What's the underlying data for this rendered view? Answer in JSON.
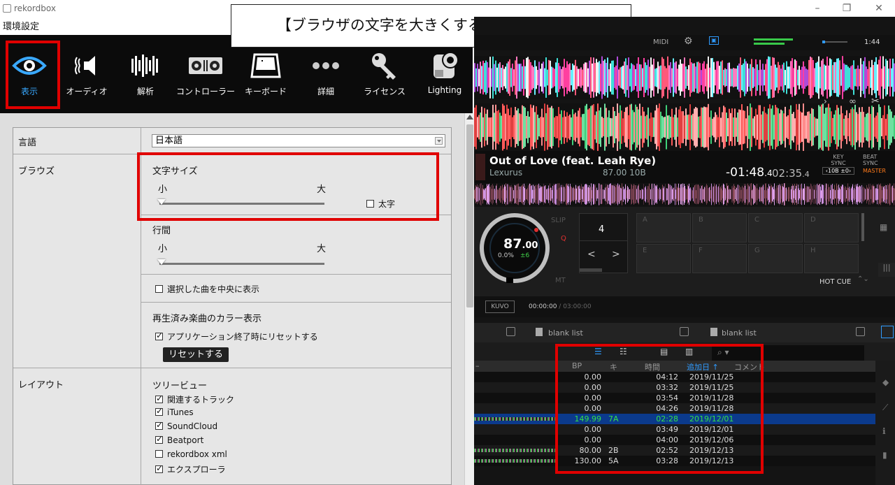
{
  "window": {
    "app_title": "rekordbox",
    "minimize": "–",
    "restore": "❐",
    "close": "✕"
  },
  "preferences": {
    "title": "環境設定",
    "categories": [
      {
        "label": "表示",
        "icon": "eye-icon",
        "active": true
      },
      {
        "label": "オーディオ",
        "icon": "speaker-icon",
        "active": false
      },
      {
        "label": "解析",
        "icon": "waveform-bars-icon",
        "active": false
      },
      {
        "label": "コントローラー",
        "icon": "controller-icon",
        "active": false
      },
      {
        "label": "キーボード",
        "icon": "keyboard-key-icon",
        "active": false
      },
      {
        "label": "詳細",
        "icon": "more-dots-icon",
        "active": false
      },
      {
        "label": "ライセンス",
        "icon": "key-icon",
        "active": false
      },
      {
        "label": "Lighting",
        "icon": "moving-head-light-icon",
        "active": false
      }
    ],
    "language": {
      "label": "言語",
      "value": "日本語"
    },
    "browse": {
      "label": "ブラウズ",
      "font_size": {
        "title": "文字サイズ",
        "min": "小",
        "max": "大",
        "value": 0
      },
      "bold": {
        "label": "太字",
        "checked": false
      },
      "line_spacing": {
        "title": "行間",
        "min": "小",
        "max": "大",
        "value": 0
      },
      "center_selected": {
        "label": "選択した曲を中央に表示",
        "checked": false
      },
      "played_color": {
        "title": "再生済み楽曲のカラー表示",
        "reset_on_exit": {
          "label": "アプリケーション終了時にリセットする",
          "checked": true
        },
        "reset_button": "リセットする"
      }
    },
    "layout": {
      "label": "レイアウト",
      "tree_title": "ツリービュー",
      "items": [
        {
          "label": "関連するトラック",
          "checked": true
        },
        {
          "label": "iTunes",
          "checked": true
        },
        {
          "label": "SoundCloud",
          "checked": true
        },
        {
          "label": "Beatport",
          "checked": true
        },
        {
          "label": "rekordbox xml",
          "checked": false
        },
        {
          "label": "エクスプローラ",
          "checked": true
        }
      ]
    }
  },
  "annotation": {
    "text": "【ブラウザの文字を大きくする、太字にする】"
  },
  "player": {
    "topbar": {
      "midi": "MIDI",
      "clock": "1:44"
    },
    "track": {
      "title": "Out of Love (feat. Leah Rye)",
      "artist": "Lexurus",
      "bpm_key": "87.00 10B",
      "remain_main": "-01:48",
      "remain_frac": ".4",
      "total_main": "02:35",
      "total_frac": ".4"
    },
    "sync": {
      "key_label": "KEY",
      "key_sync": "SYNC",
      "key_value": "10B",
      "key_shift": "±0",
      "beat_label": "BEAT",
      "beat_sync": "SYNC",
      "master": "MASTER"
    },
    "deck": {
      "bpm_int": "87",
      "bpm_dec": ".00",
      "pitch": "0.0%",
      "pitch_range": "±6",
      "slip": "SLIP",
      "quantize": "Q",
      "master_tempo": "MT",
      "beat_jump": "4",
      "prev": "<",
      "next": ">",
      "hot_cue": "HOT CUE",
      "pads": [
        "A",
        "B",
        "C",
        "D",
        "E",
        "F",
        "G",
        "H"
      ]
    },
    "playback": {
      "kuvo": "KUVO",
      "position": "00:00:00",
      "duration": "/ 03:00:00"
    }
  },
  "browser": {
    "tabs": [
      "blank list",
      "blank list"
    ],
    "headers": {
      "bpm": "BP",
      "key": "キ",
      "time": "時間",
      "date_added": "追加日",
      "sort": "↑",
      "comment": "コメント"
    },
    "rows": [
      {
        "bpm": "0.00",
        "key": "",
        "time": "04:12",
        "date": "2019/11/25",
        "selected": false
      },
      {
        "bpm": "0.00",
        "key": "",
        "time": "03:32",
        "date": "2019/11/25",
        "selected": false
      },
      {
        "bpm": "0.00",
        "key": "",
        "time": "03:54",
        "date": "2019/11/28",
        "selected": false
      },
      {
        "bpm": "0.00",
        "key": "",
        "time": "04:26",
        "date": "2019/11/28",
        "selected": false
      },
      {
        "bpm": "149.99",
        "key": "7A",
        "time": "02:28",
        "date": "2019/12/01",
        "selected": true
      },
      {
        "bpm": "0.00",
        "key": "",
        "time": "03:49",
        "date": "2019/12/01",
        "selected": false
      },
      {
        "bpm": "0.00",
        "key": "",
        "time": "04:00",
        "date": "2019/12/06",
        "selected": false
      },
      {
        "bpm": "80.00",
        "key": "2B",
        "time": "02:52",
        "date": "2019/12/13",
        "selected": false
      },
      {
        "bpm": "130.00",
        "key": "5A",
        "time": "03:28",
        "date": "2019/12/13",
        "selected": false
      }
    ]
  },
  "colors": {
    "highlight_red": "#e00000",
    "active_blue": "#38a8ff",
    "selected_row": "#0b3a8c",
    "selected_text": "#35e04a"
  }
}
